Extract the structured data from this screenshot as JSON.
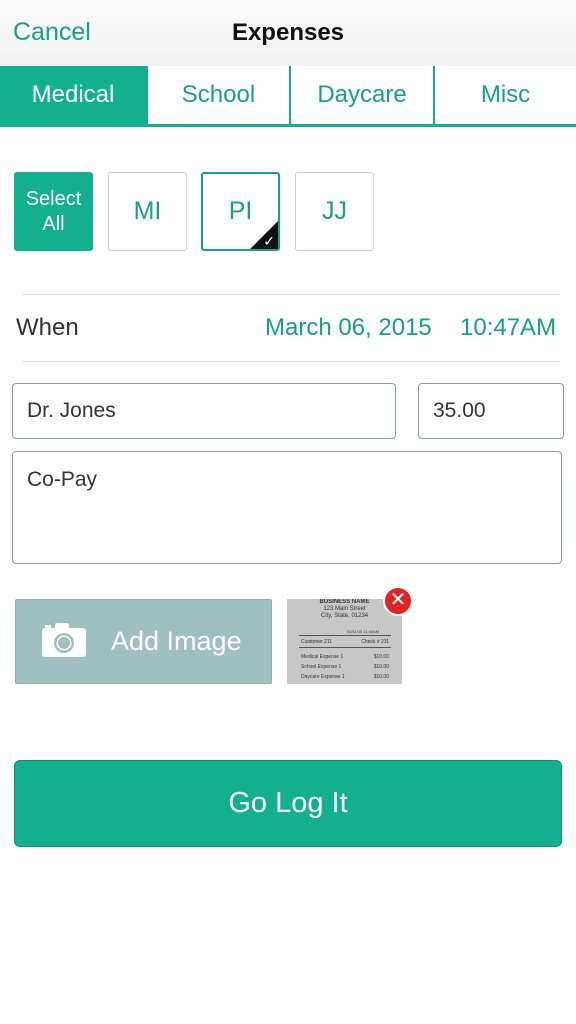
{
  "nav": {
    "cancel_label": "Cancel",
    "title": "Expenses"
  },
  "tabs": [
    {
      "label": "Medical",
      "active": true
    },
    {
      "label": "School"
    },
    {
      "label": "Daycare"
    },
    {
      "label": "Misc"
    }
  ],
  "people": {
    "select_all_line1": "Select",
    "select_all_line2": "All",
    "items": [
      {
        "label": "MI",
        "checked": false
      },
      {
        "label": "PI",
        "checked": true
      },
      {
        "label": "JJ",
        "checked": false
      }
    ]
  },
  "when": {
    "label": "When",
    "date": "March 06, 2015",
    "time": "10:47AM"
  },
  "form": {
    "name_value": "Dr. Jones",
    "amount_value": "35.00",
    "note_value": "Co-Pay"
  },
  "image": {
    "add_label": "Add Image",
    "receipt": {
      "business": "BUSINESS NAME",
      "street": "123 Main Street",
      "city": "City, State, 01234",
      "date": "02/11/15  11:40AM",
      "customer": "Customer 211",
      "check": "Check # 211",
      "rows": [
        {
          "label": "Medical   Expense 1",
          "amount": "$10.00"
        },
        {
          "label": "School    Expense 1",
          "amount": "$10.00"
        },
        {
          "label": "Daycare Expense 1",
          "amount": "$10.00"
        }
      ]
    }
  },
  "submit_label": "Go Log It",
  "colors": {
    "accent": "#12b08f",
    "accent_text": "#16a085",
    "add_image_bg": "#a0bfbf",
    "remove": "#e02424"
  }
}
